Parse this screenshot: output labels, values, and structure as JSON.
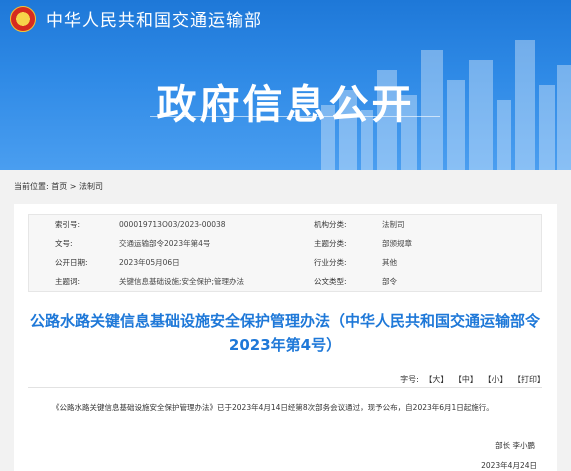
{
  "header": {
    "ministry": "中华人民共和国交通运输部",
    "banner_title": "政府信息公开"
  },
  "breadcrumb": {
    "prefix": "当前位置:",
    "home": "首页",
    "separator": ">",
    "current": "法制司"
  },
  "meta": {
    "rows": [
      {
        "l1": "索引号:",
        "v1": "000019713O03/2023-00038",
        "l2": "机构分类:",
        "v2": "法制司"
      },
      {
        "l1": "文号:",
        "v1": "交通运输部令2023年第4号",
        "l2": "主题分类:",
        "v2": "部颁规章"
      },
      {
        "l1": "公开日期:",
        "v1": "2023年05月06日",
        "l2": "行业分类:",
        "v2": "其他"
      },
      {
        "l1": "主题词:",
        "v1": "关键信息基础设施;安全保护;管理办法",
        "l2": "公文类型:",
        "v2": "部令"
      }
    ]
  },
  "document": {
    "title": "公路水路关键信息基础设施安全保护管理办法（中华人民共和国交通运输部令2023年第4号）",
    "font_label": "字号:",
    "font_large": "【大】",
    "font_medium": "【中】",
    "font_small": "【小】",
    "print": "【打印】",
    "body": "《公路水路关键信息基础设施安全保护管理办法》已于2023年4月14日经第8次部务会议通过，现予公布，自2023年6月1日起施行。",
    "signature": "部长  李小鹏",
    "date": "2023年4月24日"
  }
}
